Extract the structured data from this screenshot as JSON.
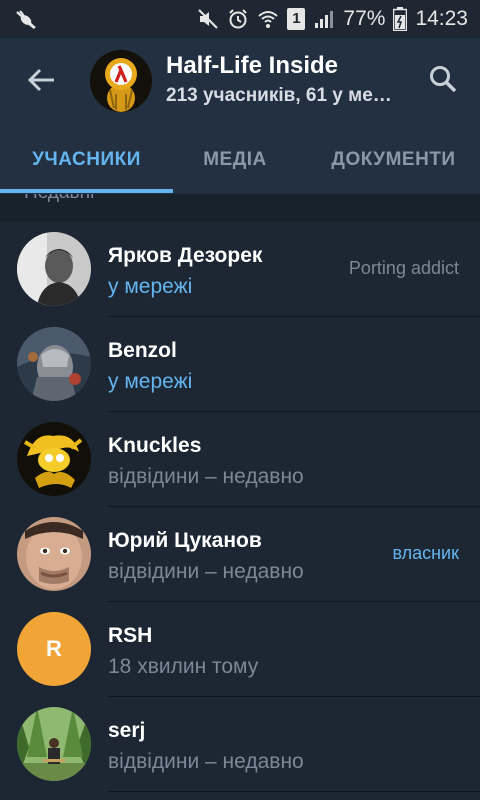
{
  "status_bar": {
    "battery": "77%",
    "time": "14:23",
    "sim_label": "1",
    "icons": [
      "bug-icon",
      "mute-icon",
      "alarm-icon",
      "wifi-icon",
      "sim-icon",
      "signal-icon",
      "battery-icon"
    ]
  },
  "header": {
    "title": "Half-Life Inside",
    "subtitle": "213 учасників, 61 у ме…",
    "avatar_icon": "lambda-logo"
  },
  "tabs": [
    {
      "label": "УЧАСНИКИ",
      "active": true
    },
    {
      "label": "МЕДІА",
      "active": false
    },
    {
      "label": "ДОКУМЕНТИ",
      "active": false
    }
  ],
  "section": {
    "label": "Недавні"
  },
  "members": [
    {
      "name": "Ярков Дезорек",
      "status": "у мережі",
      "online": true,
      "tag": "Porting addict",
      "avatar": "photo-man"
    },
    {
      "name": "Benzol",
      "status": "у мережі",
      "online": true,
      "tag": "",
      "avatar": "photo-knight"
    },
    {
      "name": "Knuckles",
      "status": "відвідини – недавно",
      "online": false,
      "tag": "",
      "avatar": "photo-knuckles"
    },
    {
      "name": "Юрий Цуканов",
      "status": "відвідини – недавно",
      "online": false,
      "tag": "власник",
      "avatar": "photo-face"
    },
    {
      "name": "RSH",
      "status": "18 хвилин тому",
      "online": false,
      "tag": "",
      "avatar_letter": "R",
      "avatar_color": "#f0a536"
    },
    {
      "name": "serj",
      "status": "відвідини – недавно",
      "online": false,
      "tag": "",
      "avatar": "photo-forest"
    }
  ],
  "colors": {
    "accent": "#64b5ef",
    "header_bg": "#233041",
    "bg": "#1d2733",
    "muted": "#7a8897"
  }
}
